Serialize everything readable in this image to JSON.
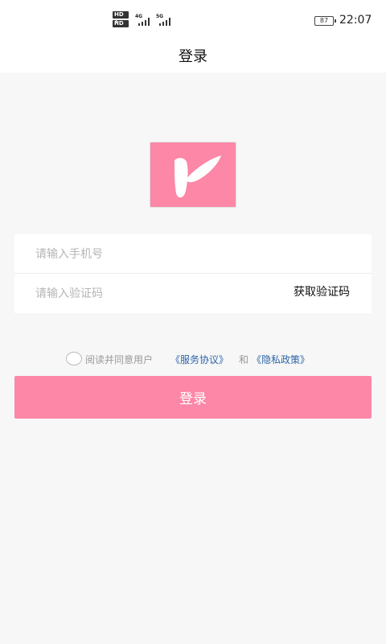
{
  "status_bar": {
    "hd1": "HD 1",
    "hd2": "HD 2",
    "signal1_label": "4G",
    "signal2_label": "5G",
    "battery": "87",
    "time": "22:07"
  },
  "header": {
    "title": "登录"
  },
  "login_form": {
    "phone_placeholder": "请输入手机号",
    "code_placeholder": "请输入验证码",
    "get_code_label": "获取验证码"
  },
  "agreement": {
    "text": "阅读并同意用户",
    "service_link": "《服务协议》",
    "and_text": "和",
    "privacy_link": "《隐私政策》"
  },
  "login_button": {
    "label": "登录"
  },
  "colors": {
    "brand_pink": "#fc87a6",
    "link_blue": "#2c65a8"
  }
}
